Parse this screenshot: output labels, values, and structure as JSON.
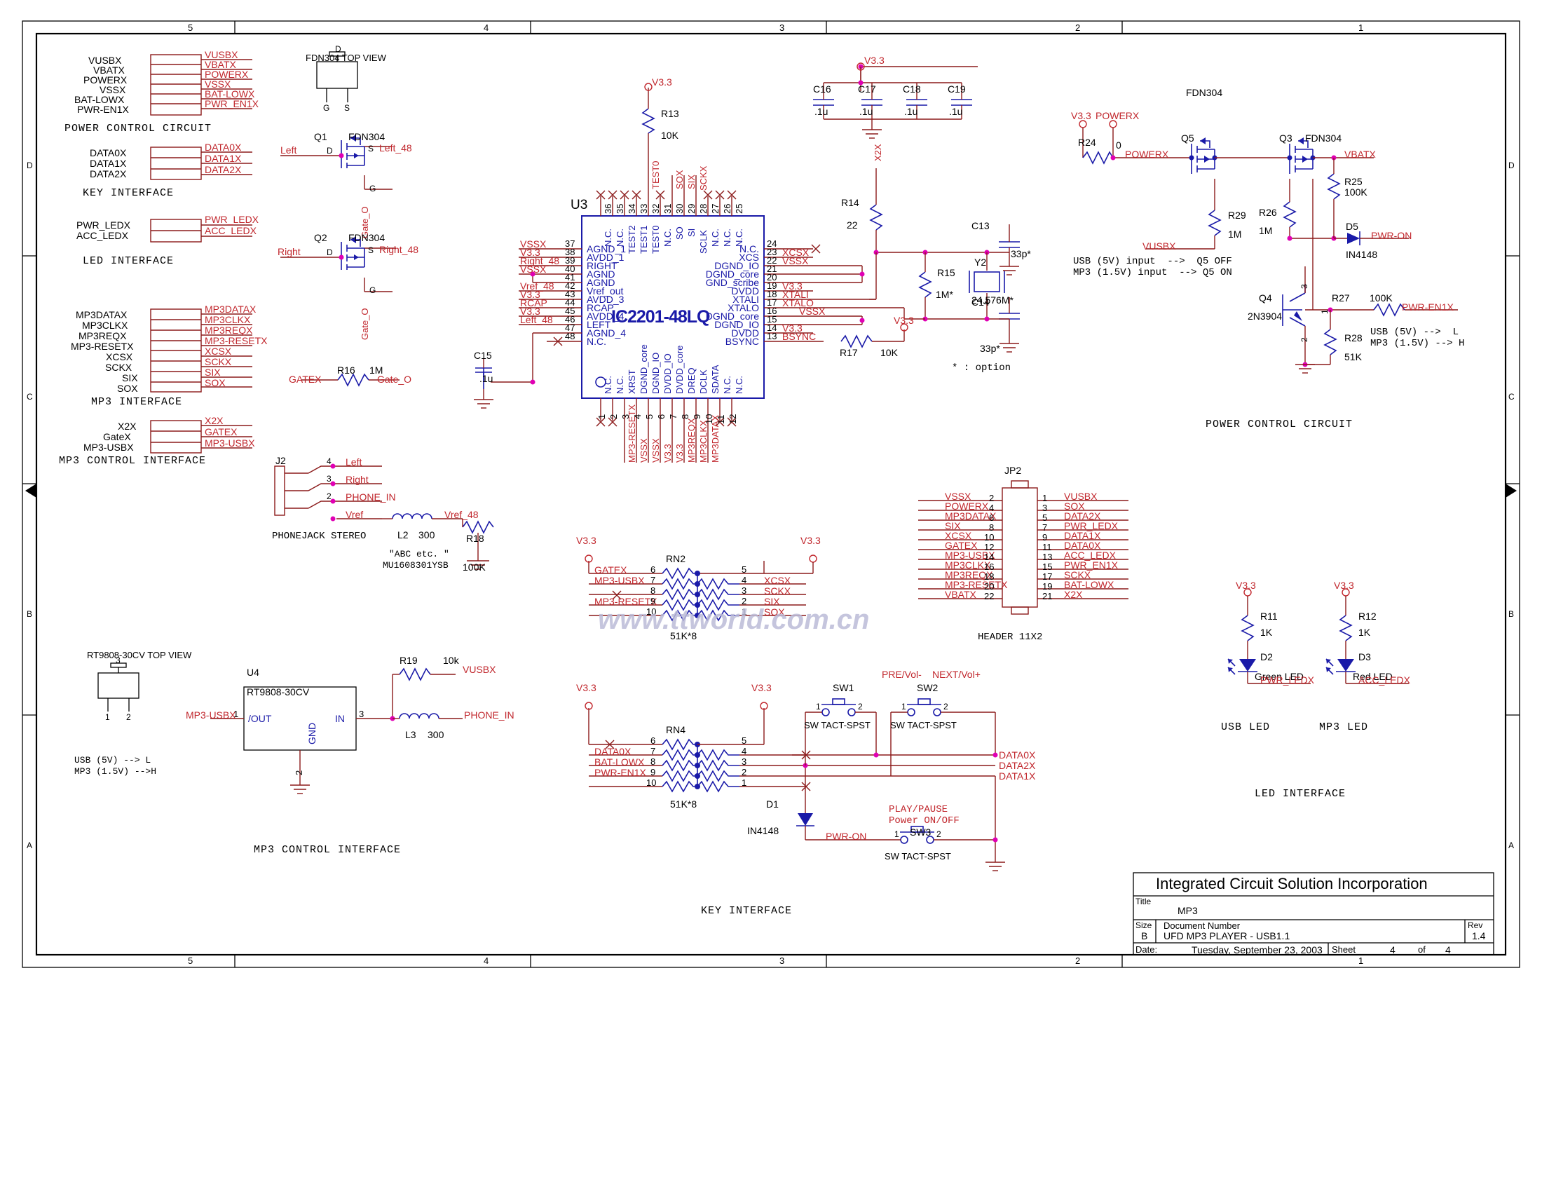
{
  "document": {
    "company": "Integrated Circuit Solution Incorporation",
    "title_label": "Title",
    "title_value": "MP3",
    "size_label": "Size",
    "size_value": "B",
    "docnum_label": "Document Number",
    "docnum_value": "UFD MP3 PLAYER - USB1.1",
    "rev_label": "Rev",
    "rev_value": "1.4",
    "date_label": "Date:",
    "date_value": "Tuesday, September 23, 2003",
    "sheet_label": "Sheet",
    "sheet_num": "4",
    "sheet_of": "of",
    "sheet_total": "4",
    "page_footer": "1",
    "watermark": "www.ttworld.com.cn"
  },
  "frame": {
    "columns": [
      "5",
      "4",
      "3",
      "2",
      "1"
    ],
    "rows": [
      "D",
      "C",
      "B",
      "A"
    ]
  },
  "blocks": {
    "power_control_interface": {
      "caption": "POWER CONTROL CIRCUIT",
      "left_pins": [
        "VUSBX",
        "VBATX",
        "POWERX",
        "VSSX",
        "BAT-LOWX",
        "PWR-EN1X"
      ],
      "right_nets": [
        "VUSBX",
        "VBATX",
        "POWERX",
        "VSSX",
        "BAT-LOWX",
        "PWR_EN1X"
      ]
    },
    "key_interface": {
      "caption": "KEY INTERFACE",
      "left_pins": [
        "DATA0X",
        "DATA1X",
        "DATA2X"
      ],
      "right_nets": [
        "DATA0X",
        "DATA1X",
        "DATA2X"
      ]
    },
    "led_interface": {
      "caption": "LED INTERFACE",
      "left_pins": [
        "PWR_LEDX",
        "ACC_LEDX"
      ],
      "right_nets": [
        "PWR_LEDX",
        "ACC_LEDX"
      ]
    },
    "mp3_interface": {
      "caption": "MP3 INTERFACE",
      "left_pins": [
        "MP3DATAX",
        "MP3CLKX",
        "MP3REQX",
        "MP3-RESETX",
        "XCSX",
        "SCKX",
        "SIX",
        "SOX"
      ],
      "right_nets": [
        "MP3DATAX",
        "MP3CLKX",
        "MP3REQX",
        "MP3-RESETX",
        "XCSX",
        "SCKX",
        "SIX",
        "SOX"
      ]
    },
    "mp3_control_interface": {
      "caption": "MP3 CONTROL INTERFACE",
      "left_pins": [
        "X2X",
        "GateX",
        "MP3-USBX"
      ],
      "right_nets": [
        "X2X",
        "GATEX",
        "MP3-USBX"
      ]
    }
  },
  "fdn304_top_view": {
    "caption": "FDN304 TOP VIEW",
    "pins": [
      "G",
      "S",
      "D"
    ]
  },
  "rt9808_top_view": {
    "caption": "RT9808-30CV TOP VIEW",
    "pins": [
      "3",
      "1",
      "2"
    ],
    "note1": "USB (5V) --> L",
    "note2": "MP3 (1.5V) -->H"
  },
  "mosfets": {
    "q1": {
      "ref": "Q1",
      "part": "FDN304",
      "left_net": "Left",
      "d": "D",
      "s": "S",
      "g": "G",
      "out_net": "Left_48",
      "gate_net": "Gate_O"
    },
    "q2": {
      "ref": "Q2",
      "part": "FDN304",
      "left_net": "Right",
      "d": "D",
      "s": "S",
      "g": "G",
      "out_net": "Right_48",
      "gate_net": "Gate_O"
    },
    "r16": {
      "ref": "R16",
      "value": "1M",
      "left_net": "GATEX",
      "right_net": "Gate_O"
    }
  },
  "u3": {
    "ref": "U3",
    "part": "IC2201-48LQ",
    "left_pins": [
      {
        "num": "37",
        "name": "AGND_1",
        "net": "VSSX"
      },
      {
        "num": "38",
        "name": "AVDD_1",
        "net": "V3.3"
      },
      {
        "num": "39",
        "name": "RIGHT",
        "net": "Right_48"
      },
      {
        "num": "40",
        "name": "AGND",
        "net": "VSSX"
      },
      {
        "num": "41",
        "name": "AGND",
        "net": ""
      },
      {
        "num": "42",
        "name": "Vref_out",
        "net": "Vref_48"
      },
      {
        "num": "43",
        "name": "AVDD_3",
        "net": "V3.3"
      },
      {
        "num": "44",
        "name": "RCAP",
        "net": "RCAP"
      },
      {
        "num": "45",
        "name": "AVDD_4",
        "net": "V3.3"
      },
      {
        "num": "46",
        "name": "LEFT",
        "net": "Left_48"
      },
      {
        "num": "47",
        "name": "AGND_4",
        "net": ""
      },
      {
        "num": "48",
        "name": "N.C.",
        "net": ""
      }
    ],
    "right_pins": [
      {
        "num": "24",
        "name": "N.C.",
        "net": ""
      },
      {
        "num": "23",
        "name": "XCS",
        "net": "XCSX"
      },
      {
        "num": "22",
        "name": "DGND_IO",
        "net": "VSSX"
      },
      {
        "num": "21",
        "name": "DGND_core",
        "net": ""
      },
      {
        "num": "20",
        "name": "GND_scribe",
        "net": ""
      },
      {
        "num": "19",
        "name": "DVDD",
        "net": "V3.3"
      },
      {
        "num": "18",
        "name": "XTALI",
        "net": "XTALI"
      },
      {
        "num": "17",
        "name": "XTALO",
        "net": "XTALO"
      },
      {
        "num": "16",
        "name": "DGND_core",
        "net": "VSSX"
      },
      {
        "num": "15",
        "name": "DGND_IO",
        "net": ""
      },
      {
        "num": "14",
        "name": "DVDD",
        "net": "V3.3"
      },
      {
        "num": "13",
        "name": "BSYNC",
        "net": "BSYNC"
      }
    ],
    "top_pins": [
      {
        "num": "36",
        "name": "N.C.",
        "net": ""
      },
      {
        "num": "35",
        "name": "N.C.",
        "net": ""
      },
      {
        "num": "34",
        "name": "TEST2",
        "net": ""
      },
      {
        "num": "33",
        "name": "TEST1",
        "net": ""
      },
      {
        "num": "32",
        "name": "TEST0",
        "net": "TEST0"
      },
      {
        "num": "31",
        "name": "N.C.",
        "net": ""
      },
      {
        "num": "30",
        "name": "SO",
        "net": "SOX"
      },
      {
        "num": "29",
        "name": "SI",
        "net": "SIX"
      },
      {
        "num": "28",
        "name": "SCLK",
        "net": "SCKX"
      },
      {
        "num": "27",
        "name": "N.C.",
        "net": ""
      },
      {
        "num": "26",
        "name": "N.C.",
        "net": ""
      },
      {
        "num": "25",
        "name": "N.C.",
        "net": ""
      }
    ],
    "bottom_pins": [
      {
        "num": "1",
        "name": "N.C.",
        "net": ""
      },
      {
        "num": "2",
        "name": "N.C.",
        "net": ""
      },
      {
        "num": "3",
        "name": "XRST",
        "net": "MP3-RESETX"
      },
      {
        "num": "4",
        "name": "DGND_core",
        "net": "VSSX"
      },
      {
        "num": "5",
        "name": "DGND_IO",
        "net": "VSSX"
      },
      {
        "num": "6",
        "name": "DVDD_IO",
        "net": "V3.3"
      },
      {
        "num": "7",
        "name": "DVDD_core",
        "net": "V3.3"
      },
      {
        "num": "8",
        "name": "DREQ",
        "net": "MP3REQX"
      },
      {
        "num": "9",
        "name": "DCLK",
        "net": "MP3CLKX"
      },
      {
        "num": "10",
        "name": "SDATA",
        "net": "MP3DATAX"
      },
      {
        "num": "11",
        "name": "N.C.",
        "net": ""
      },
      {
        "num": "12",
        "name": "N.C.",
        "net": ""
      }
    ]
  },
  "components": {
    "r13": {
      "ref": "R13",
      "value": "10K",
      "rail": "V3.3"
    },
    "r14": {
      "ref": "R14",
      "value": "22",
      "net": "X2X"
    },
    "r15": {
      "ref": "R15",
      "value": "1M*"
    },
    "r17": {
      "ref": "R17",
      "value": "10K",
      "rail": "V3.3"
    },
    "r18": {
      "ref": "R18",
      "value": "100K"
    },
    "r19": {
      "ref": "R19",
      "value": "10k"
    },
    "r24": {
      "ref": "R24",
      "value": "0"
    },
    "r25": {
      "ref": "R25",
      "value": "100K"
    },
    "r26": {
      "ref": "R26",
      "value": "1M"
    },
    "r27": {
      "ref": "R27",
      "value": "100K"
    },
    "r28": {
      "ref": "R28",
      "value": "51K"
    },
    "r29": {
      "ref": "R29",
      "value": "1M"
    },
    "r11": {
      "ref": "R11",
      "value": "1K"
    },
    "r12": {
      "ref": "R12",
      "value": "1K"
    },
    "c13": {
      "ref": "C13",
      "value": "33p*"
    },
    "c14": {
      "ref": "C14",
      "value": "33p*"
    },
    "c15": {
      "ref": "C15",
      "value": ".1u"
    },
    "c16": {
      "ref": "C16",
      "value": ".1u"
    },
    "c17": {
      "ref": "C17",
      "value": ".1u"
    },
    "c18": {
      "ref": "C18",
      "value": ".1u"
    },
    "c19": {
      "ref": "C19",
      "value": ".1u"
    },
    "y2": {
      "ref": "Y2",
      "value": "24.576M*"
    },
    "option_note": "* : option",
    "l2": {
      "ref": "L2",
      "value": "300"
    },
    "l3": {
      "ref": "L3",
      "value": "300"
    },
    "u4": {
      "ref": "U4",
      "part": "RT9808-30CV",
      "pin_out": "/OUT",
      "pin_in": "IN",
      "pin_gnd": "GND",
      "pin_out_num": "1",
      "pin_in_num": "3",
      "pin_gnd_num": "2"
    },
    "d1": {
      "ref": "D1",
      "part": "IN4148"
    },
    "d5": {
      "ref": "D5",
      "part": "IN4148"
    },
    "d2": {
      "ref": "D2",
      "part": "Green LED"
    },
    "d3": {
      "ref": "D3",
      "part": "Red LED"
    },
    "q3": {
      "ref": "Q3",
      "part": "FDN304"
    },
    "q4": {
      "ref": "Q4",
      "part": "2N3904",
      "pins": [
        "3",
        "1",
        "2"
      ]
    },
    "q5": {
      "ref": "Q5",
      "part": "FDN304"
    }
  },
  "phonejack": {
    "ref": "J2",
    "caption": "PHONEJACK STEREO",
    "pins": [
      "4",
      "3",
      "2"
    ],
    "labels": [
      "Left",
      "Right",
      "PHONE_IN",
      "Vref"
    ],
    "out_net": "Vref_48",
    "note1": "\"ABC etc. \"",
    "note2": "MU1608301YSB"
  },
  "power_circuit_right": {
    "caption": "POWER CONTROL CIRCUIT",
    "rail": "V3.3",
    "net_powerx_port": "POWERX",
    "net_powerx": "POWERX",
    "net_vusbx": "VUSBX",
    "net_vbatx": "VBATX",
    "net_pwron": "PWR-ON",
    "net_pwren1x": "PWR-EN1X",
    "note_a1": "USB (5V) input  -->  Q5 OFF",
    "note_a2": "MP3 (1.5V) input  --> Q5 ON",
    "note_b1": "USB (5V) -->  L",
    "note_b2": "MP3 (1.5V) --> H"
  },
  "mp3_control_bottom": {
    "caption": "MP3 CONTROL INTERFACE",
    "in_net": "MP3-USBX",
    "out_net": "VUSBX",
    "phone_net": "PHONE_IN"
  },
  "rn2": {
    "ref": "RN2",
    "value": "51K*8",
    "rail_left": "V3.3",
    "rail_right": "V3.3",
    "left_labels": [
      "GATEX",
      "MP3-USBX",
      "",
      "MP3-RESETX",
      ""
    ],
    "left_nums": [
      "6",
      "7",
      "8",
      "9",
      "10"
    ],
    "right_nums": [
      "5",
      "4",
      "3",
      "2",
      "1"
    ],
    "right_labels": [
      "",
      "XCSX",
      "SCKX",
      "SIX",
      "SOX"
    ]
  },
  "rn4": {
    "ref": "RN4",
    "value": "51K*8",
    "rail_left": "V3.3",
    "rail_right": "V3.3",
    "left_labels": [
      "",
      "DATA0X",
      "BAT-LOWX",
      "PWR-EN1X",
      ""
    ],
    "left_nums": [
      "6",
      "7",
      "8",
      "9",
      "10"
    ],
    "right_nums": [
      "5",
      "4",
      "3",
      "2",
      "1"
    ],
    "out_labels": [
      "DATA0X",
      "DATA2X",
      "DATA1X"
    ]
  },
  "jp2": {
    "ref": "JP2",
    "caption": "HEADER 11X2",
    "left": [
      {
        "num": "2",
        "net": "VSSX"
      },
      {
        "num": "4",
        "net": "POWERX"
      },
      {
        "num": "6",
        "net": "MP3DATAX"
      },
      {
        "num": "8",
        "net": "SIX"
      },
      {
        "num": "10",
        "net": "XCSX"
      },
      {
        "num": "12",
        "net": "GATEX"
      },
      {
        "num": "14",
        "net": "MP3-USBX"
      },
      {
        "num": "16",
        "net": "MP3CLKX"
      },
      {
        "num": "18",
        "net": "MP3REQX"
      },
      {
        "num": "20",
        "net": "MP3-RESETX"
      },
      {
        "num": "22",
        "net": "VBATX"
      }
    ],
    "right": [
      {
        "num": "1",
        "net": "VUSBX"
      },
      {
        "num": "3",
        "net": "SOX"
      },
      {
        "num": "5",
        "net": "DATA2X"
      },
      {
        "num": "7",
        "net": "PWR_LEDX"
      },
      {
        "num": "9",
        "net": "DATA1X"
      },
      {
        "num": "11",
        "net": "DATA0X"
      },
      {
        "num": "13",
        "net": "ACC_LEDX"
      },
      {
        "num": "15",
        "net": "PWR_EN1X"
      },
      {
        "num": "17",
        "net": "SCKX"
      },
      {
        "num": "19",
        "net": "BAT-LOWX"
      },
      {
        "num": "21",
        "net": "X2X"
      }
    ]
  },
  "switches": {
    "sw1": {
      "ref": "SW1",
      "part": "SW TACT-SPST",
      "label": "PRE/Vol-",
      "pins": [
        "1",
        "2"
      ]
    },
    "sw2": {
      "ref": "SW2",
      "part": "SW TACT-SPST",
      "label": "NEXT/Vol+",
      "pins": [
        "1",
        "2"
      ]
    },
    "sw3": {
      "ref": "SW3",
      "part": "SW TACT-SPST",
      "label1": "PLAY/PAUSE",
      "label2": "Power ON/OFF",
      "pins": [
        "1",
        "2"
      ]
    },
    "caption": "KEY INTERFACE",
    "pwr_on_net": "PWR-ON"
  },
  "led_block": {
    "caption": "LED INTERFACE",
    "usb_led_caption": "USB LED",
    "mp3_led_caption": "MP3 LED",
    "rail": "V3.3",
    "pwr_ledx": "PWR_LEDX",
    "acc_ledx": "ACC_LEDX"
  }
}
